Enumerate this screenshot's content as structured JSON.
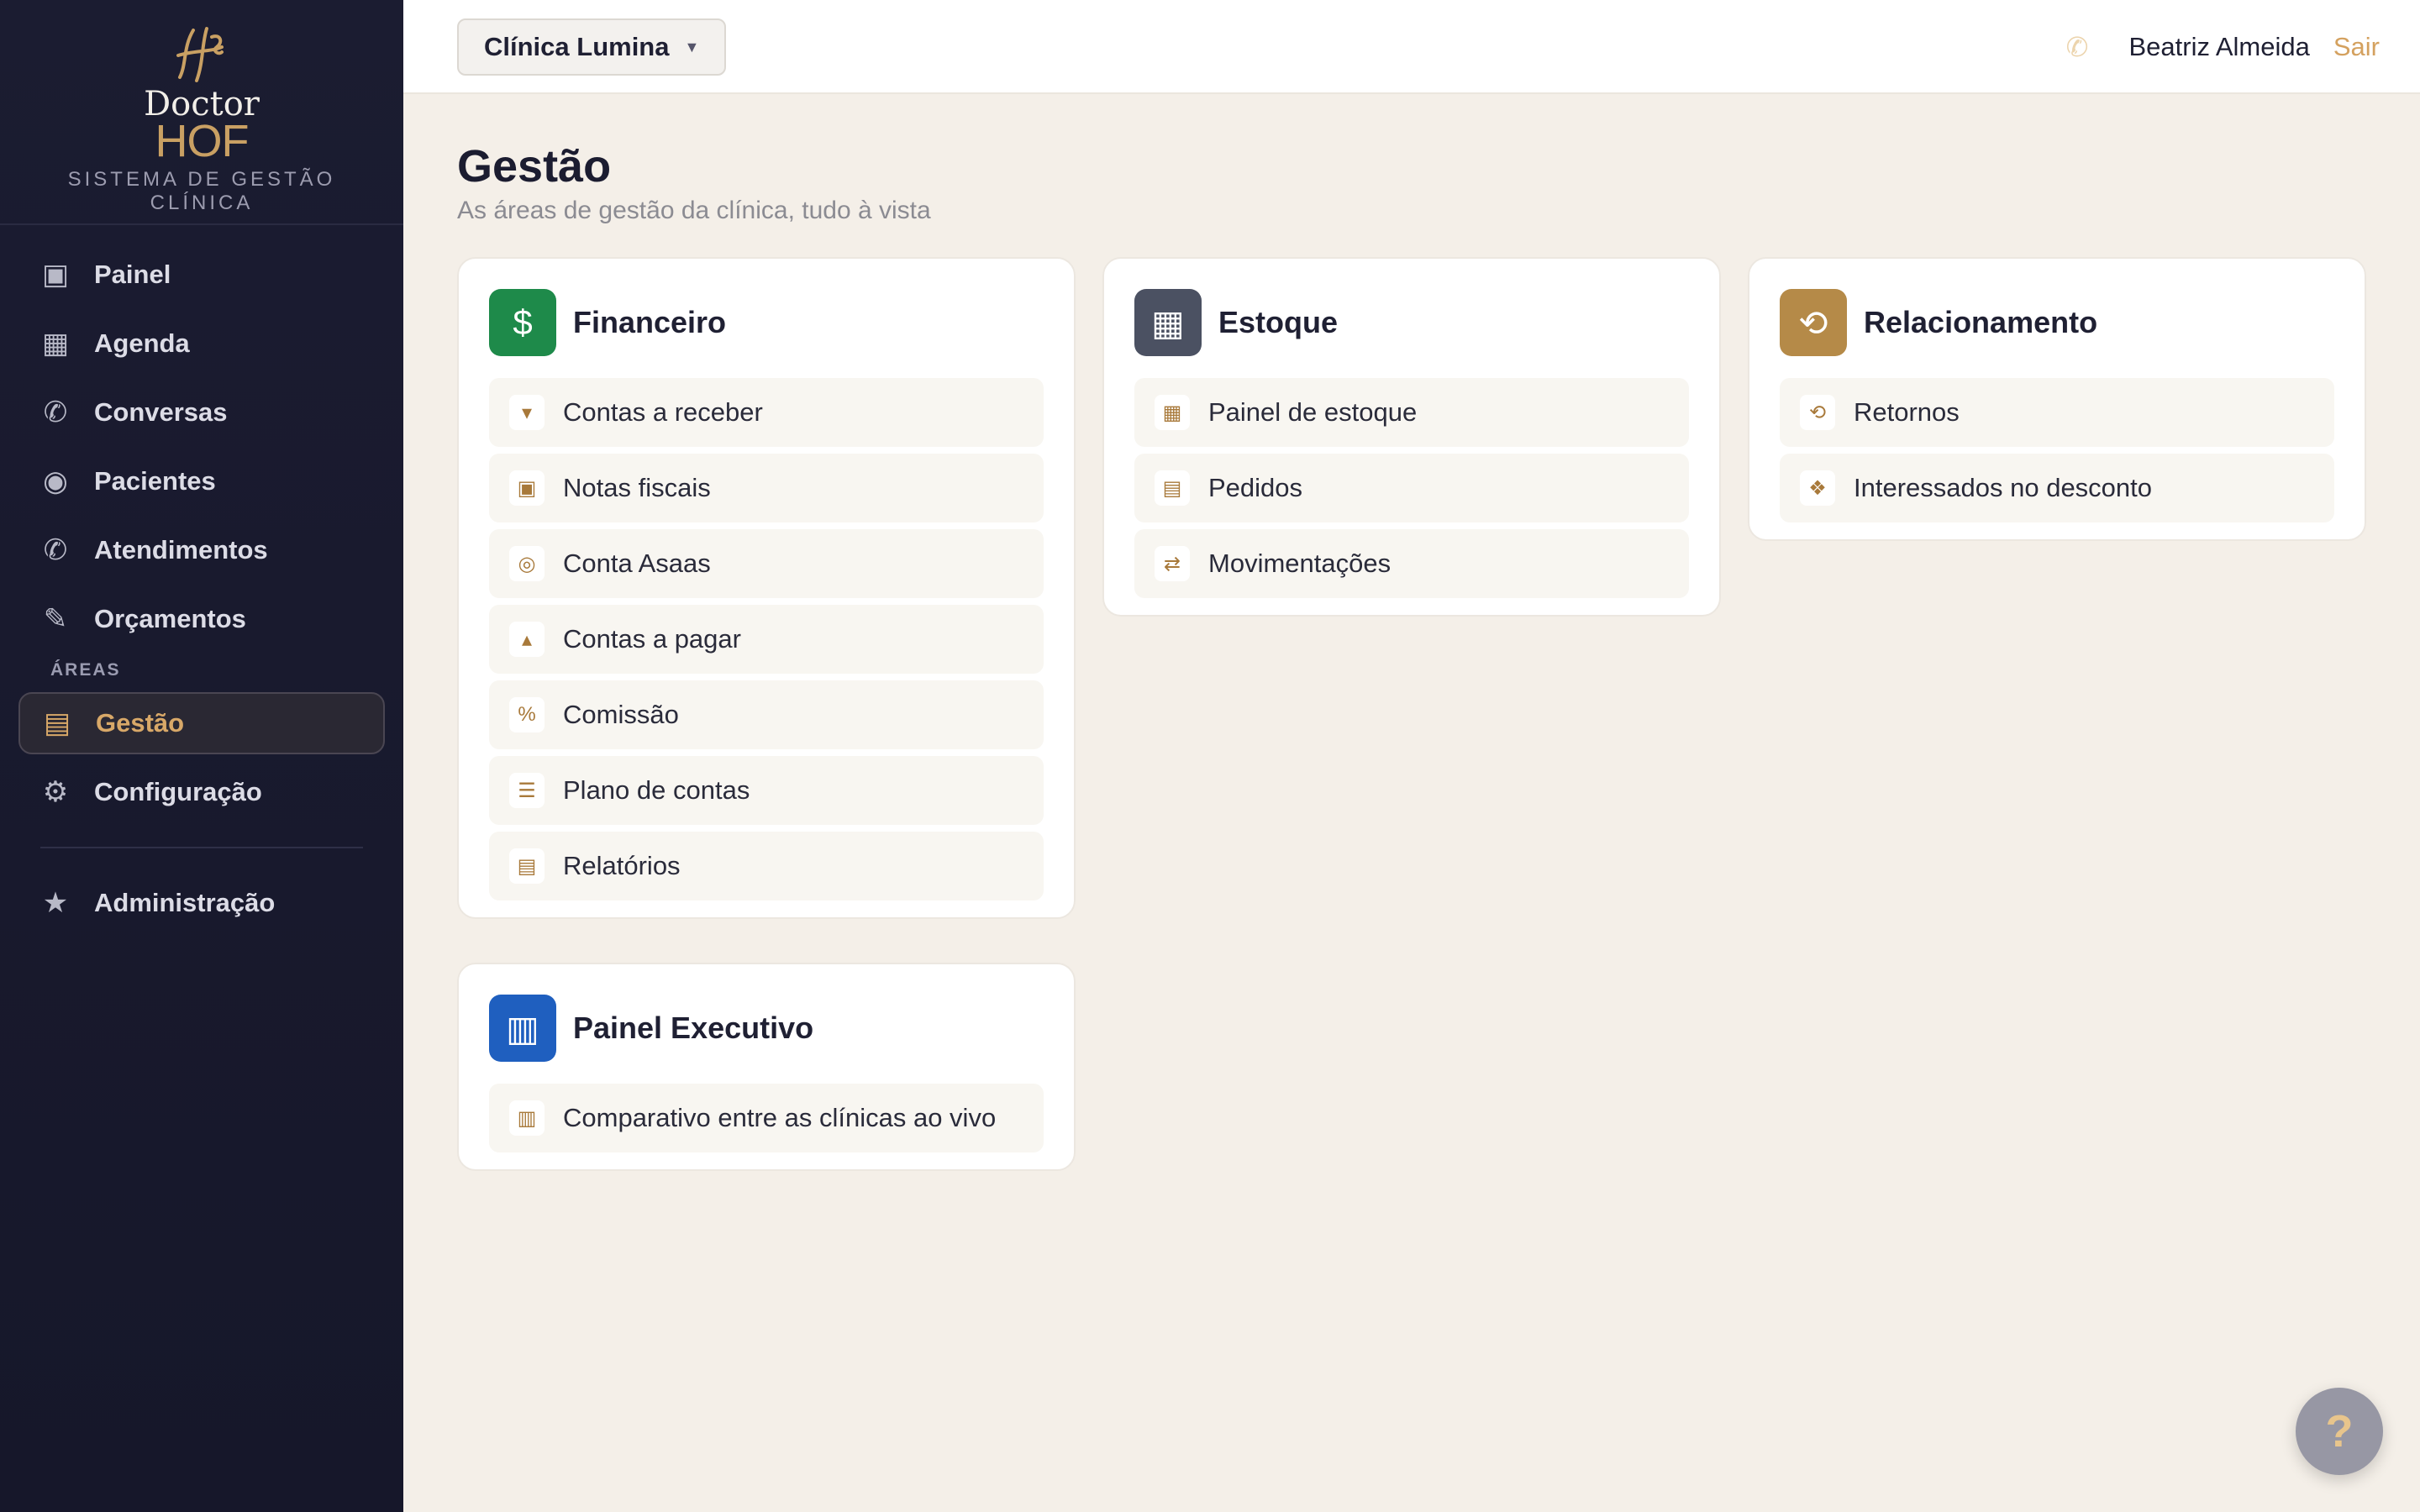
{
  "brand": {
    "line1": "Doctor",
    "line2": "HOF",
    "subtitle": "SISTEMA DE GESTÃO CLÍNICA"
  },
  "sidebar": {
    "items": [
      {
        "label": "Painel",
        "icon": "dashboard-icon"
      },
      {
        "label": "Agenda",
        "icon": "calendar-icon"
      },
      {
        "label": "Conversas",
        "icon": "chat-icon"
      },
      {
        "label": "Pacientes",
        "icon": "patient-icon"
      },
      {
        "label": "Atendimentos",
        "icon": "phone-icon"
      },
      {
        "label": "Orçamentos",
        "icon": "pencil-icon"
      }
    ],
    "section_label": "ÁREAS",
    "areas": [
      {
        "label": "Gestão",
        "icon": "management-icon",
        "active": true
      },
      {
        "label": "Configuração",
        "icon": "gear-icon"
      }
    ],
    "admin": {
      "label": "Administração",
      "icon": "star-icon"
    }
  },
  "topbar": {
    "clinic": "Clínica Lumina",
    "user_name": "Beatriz Almeida",
    "logout": "Sair"
  },
  "page": {
    "title": "Gestão",
    "subtitle": "As áreas de gestão da clínica, tudo à vista"
  },
  "cards": {
    "financeiro": {
      "title": "Financeiro",
      "color": "#1e8a4a",
      "items": [
        {
          "label": "Contas a receber",
          "icon": "arrow-down-icon"
        },
        {
          "label": "Notas fiscais",
          "icon": "invoice-icon"
        },
        {
          "label": "Conta Asaas",
          "icon": "bank-icon"
        },
        {
          "label": "Contas a pagar",
          "icon": "arrow-up-icon"
        },
        {
          "label": "Comissão",
          "icon": "percent-icon"
        },
        {
          "label": "Plano de contas",
          "icon": "list-icon"
        },
        {
          "label": "Relatórios",
          "icon": "report-icon"
        }
      ]
    },
    "estoque": {
      "title": "Estoque",
      "color": "#4b5162",
      "items": [
        {
          "label": "Painel de estoque",
          "icon": "grid-icon"
        },
        {
          "label": "Pedidos",
          "icon": "order-icon"
        },
        {
          "label": "Movimentações",
          "icon": "swap-icon"
        }
      ]
    },
    "relacionamento": {
      "title": "Relacionamento",
      "color": "#b58a48",
      "items": [
        {
          "label": "Retornos",
          "icon": "return-icon"
        },
        {
          "label": "Interessados no desconto",
          "icon": "tag-icon"
        }
      ]
    },
    "executivo": {
      "title": "Painel Executivo",
      "color": "#1f5fbf",
      "items": [
        {
          "label": "Comparativo entre as clínicas ao vivo",
          "icon": "bar-chart-icon"
        }
      ]
    }
  },
  "help": {
    "label": "?"
  }
}
